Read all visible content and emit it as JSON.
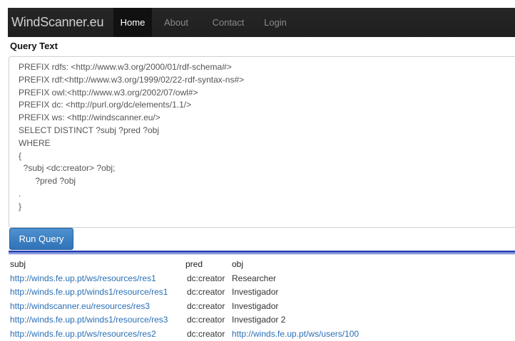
{
  "navbar": {
    "brand": "WindScanner.eu",
    "links": [
      "Home",
      "About",
      "Contact",
      "Login"
    ]
  },
  "query": {
    "label": "Query Text",
    "lines": [
      "PREFIX rdfs: <http://www.w3.org/2000/01/rdf-schema#>",
      "PREFIX rdf:<http://www.w3.org/1999/02/22-rdf-syntax-ns#>",
      "PREFIX owl:<http://www.w3.org/2002/07/owl#>",
      "PREFIX dc: <http://purl.org/dc/elements/1.1/>",
      "PREFIX ws: <http://windscanner.eu/>",
      "SELECT DISTINCT ?subj ?pred ?obj",
      "WHERE",
      "{",
      "  ?subj <dc:creator> ?obj;",
      "       ?pred ?obj",
      ".",
      "}"
    ],
    "run_label": "Run Query"
  },
  "results": {
    "headers": {
      "subj": "subj",
      "pred": "pred",
      "obj": "obj"
    },
    "rows": [
      {
        "subj": "http://winds.fe.up.pt/ws/resources/res1",
        "pred": "dc:creator",
        "obj": "Researcher"
      },
      {
        "subj": "http://winds.fe.up.pt/winds1/resource/res1",
        "pred": "dc:creator",
        "obj": "Investigador"
      },
      {
        "subj": "http://windscanner.eu/resources/res3",
        "pred": "dc:creator",
        "obj": "Investigador"
      },
      {
        "subj": "http://winds.fe.up.pt/winds1/resource/res3",
        "pred": "dc:creator",
        "obj": "Investigador 2"
      },
      {
        "subj": "http://winds.fe.up.pt/ws/resources/res2",
        "pred": "dc:creator",
        "obj": "http://winds.fe.up.pt/ws/users/100"
      }
    ]
  },
  "colors": {
    "link": "#2a6fb5",
    "button": "#3a7fc4",
    "divider": "#2a45b8",
    "navbar": "#222222"
  }
}
